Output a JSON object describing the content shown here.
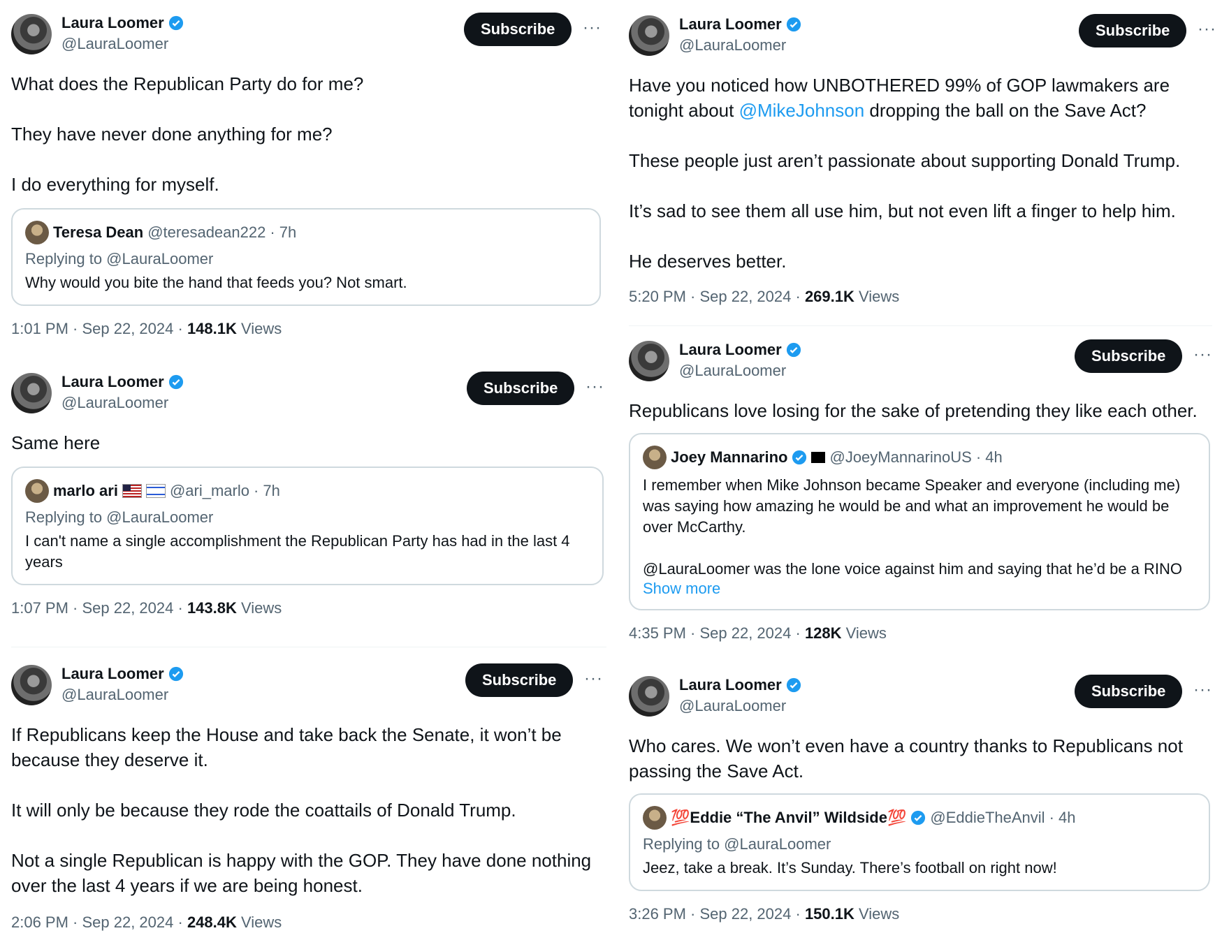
{
  "colors": {
    "accent": "#1d9bf0",
    "text": "#0f1419",
    "muted": "#536471",
    "button": "#0f1419",
    "border": "#cfd9de"
  },
  "author": {
    "name": "Laura Loomer",
    "handle": "@LauraLoomer",
    "verified": true,
    "subscribe_label": "Subscribe",
    "more_label": "···"
  },
  "tweets": [
    {
      "paras": [
        "What does the Republican Party do for me?",
        "They have never done anything for me?",
        "I do everything for myself."
      ],
      "quote": {
        "name": "Teresa Dean",
        "handle": "@teresadean222",
        "time": "· 7h",
        "replying": "Replying to @LauraLoomer",
        "text": "Why would you bite the hand that feeds you? Not smart."
      },
      "time": "1:01 PM · Sep 22, 2024 · ",
      "views": "148.1K",
      "views_label": " Views"
    },
    {
      "paras": [
        "Same here"
      ],
      "quote": {
        "name": "marlo ari",
        "handle": "@ari_marlo",
        "time": "· 7h",
        "replying": "Replying to @LauraLoomer",
        "text": "I can't name a single accomplishment the Republican Party has had in the last 4 years"
      },
      "time": "1:07 PM · Sep 22, 2024 · ",
      "views": "143.8K",
      "views_label": " Views"
    },
    {
      "paras": [
        "If Republicans keep the House and take back the Senate, it won’t be because they deserve it.",
        "It will only be because they rode the coattails of Donald Trump.",
        "Not a single Republican is happy with the GOP. They have done nothing over the last 4 years if we are being honest."
      ],
      "time": "2:06 PM · Sep 22, 2024 · ",
      "views": "248.4K",
      "views_label": " Views"
    },
    {
      "p1_before": "Have you noticed how UNBOTHERED 99% of GOP lawmakers are tonight about ",
      "p1_mention": "@MikeJohnson",
      "p1_after": " dropping the ball on the Save Act?",
      "paras": [
        "These people just aren’t passionate about supporting Donald Trump.",
        "It’s sad to see them all use him, but not even lift a finger to help him.",
        "He deserves better."
      ],
      "time": "5:20 PM · Sep 22, 2024 · ",
      "views": "269.1K",
      "views_label": " Views"
    },
    {
      "paras": [
        "Republicans love losing for the sake of pretending they like each other."
      ],
      "quote": {
        "name": "Joey Mannarino",
        "handle": "@JoeyMannarinoUS",
        "time": "· 4h",
        "text1": "I remember when Mike Johnson became Speaker and everyone (including me) was saying how amazing he would be and what an improvement he would be over McCarthy.",
        "text2": "@LauraLoomer was the lone voice against him and saying that he’d be a RINO",
        "show_more": "Show more"
      },
      "time": "4:35 PM · Sep 22, 2024 · ",
      "views": "128K",
      "views_label": " Views"
    },
    {
      "paras": [
        "Who cares. We won’t even have a country thanks to Republicans not passing the Save Act."
      ],
      "quote": {
        "name": "💯Eddie “The Anvil” Wildside💯",
        "handle": "@EddieTheAnvil",
        "time": "· 4h",
        "replying": "Replying to @LauraLoomer",
        "text": "Jeez, take a break. It’s Sunday. There’s football on right now!"
      },
      "time": "3:26 PM · Sep 22, 2024 · ",
      "views": "150.1K",
      "views_label": " Views"
    }
  ]
}
